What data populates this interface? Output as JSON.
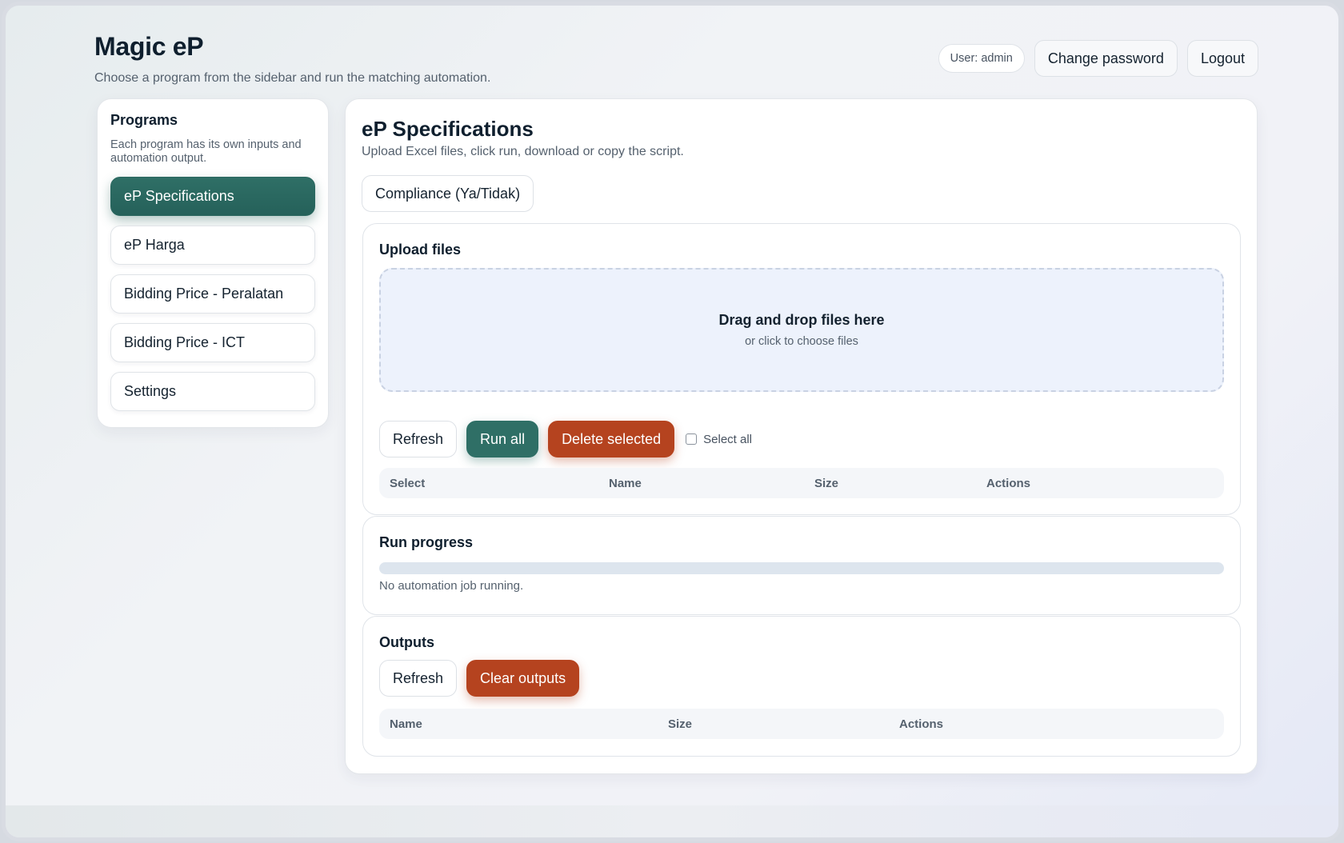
{
  "header": {
    "title": "Magic eP",
    "subtitle": "Choose a program from the sidebar and run the matching automation.",
    "user_label": "User: admin",
    "change_password": "Change password",
    "logout": "Logout"
  },
  "sidebar": {
    "title": "Programs",
    "description": "Each program has its own inputs and automation output.",
    "items": [
      {
        "label": "eP Specifications",
        "active": true
      },
      {
        "label": "eP Harga",
        "active": false
      },
      {
        "label": "Bidding Price - Peralatan",
        "active": false
      },
      {
        "label": "Bidding Price - ICT",
        "active": false
      },
      {
        "label": "Settings",
        "active": false
      }
    ]
  },
  "main": {
    "title": "eP Specifications",
    "subtitle": "Upload Excel files, click run, download or copy the script.",
    "mode": "Compliance (Ya/Tidak)"
  },
  "upload": {
    "title": "Upload files",
    "dropzone_main": "Drag and drop files here",
    "dropzone_sub": "or click to choose files",
    "refresh": "Refresh",
    "run_all": "Run all",
    "delete_selected": "Delete selected",
    "select_all": "Select all",
    "columns": [
      "Select",
      "Name",
      "Size",
      "Actions"
    ]
  },
  "progress": {
    "title": "Run progress",
    "value": 0,
    "status": "No automation job running."
  },
  "outputs": {
    "title": "Outputs",
    "refresh": "Refresh",
    "clear": "Clear outputs",
    "columns": [
      "Name",
      "Size",
      "Actions"
    ]
  },
  "colors": {
    "accent": "#2f6f66",
    "danger": "#b5431f",
    "dropzone": "#edf2fc"
  }
}
